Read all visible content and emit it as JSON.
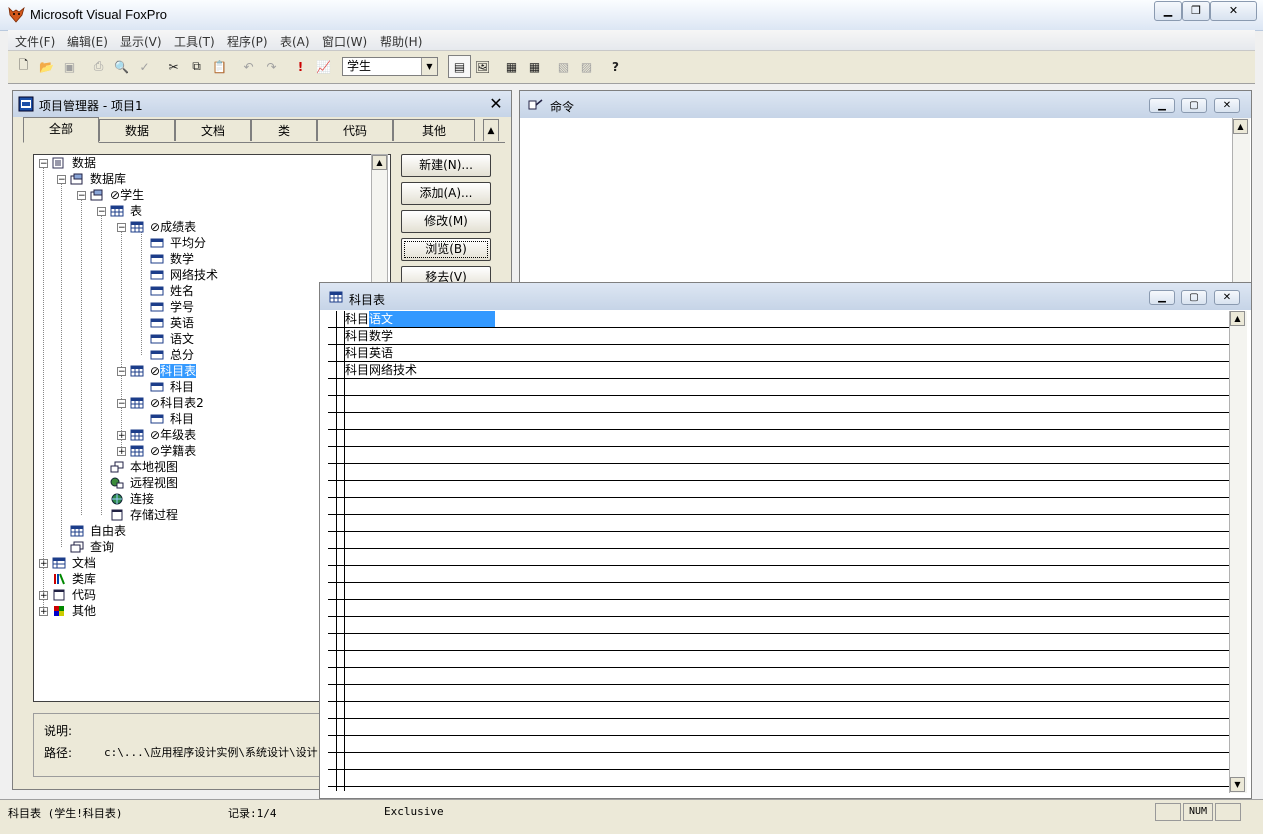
{
  "window": {
    "title": "Microsoft Visual FoxPro"
  },
  "menu": [
    "文件(F)",
    "编辑(E)",
    "显示(V)",
    "工具(T)",
    "程序(P)",
    "表(A)",
    "窗口(W)",
    "帮助(H)"
  ],
  "toolbar": {
    "database_select": "学生",
    "help_icon": "?"
  },
  "project_manager": {
    "title": "项目管理器 - 项目1",
    "tabs": [
      "全部",
      "数据",
      "文档",
      "类",
      "代码",
      "其他"
    ],
    "tree": {
      "data": "数据",
      "database": "数据库",
      "db_student": "学生",
      "tables": "表",
      "t_score": "成绩表",
      "score_fields": [
        "平均分",
        "数学",
        "网络技术",
        "姓名",
        "学号",
        "英语",
        "语文",
        "总分"
      ],
      "t_subject": "科目表",
      "t_subject_fields": [
        "科目"
      ],
      "t_subject2": "科目表2",
      "t_subject2_fields": [
        "科目"
      ],
      "t_grade": "年级表",
      "t_roll": "学籍表",
      "local_view": "本地视图",
      "remote_view": "远程视图",
      "connection": "连接",
      "stored_proc": "存储过程",
      "free_table": "自由表",
      "query": "查询",
      "docs": "文档",
      "class_lib": "类库",
      "code": "代码",
      "other": "其他"
    },
    "buttons": [
      "新建(N)...",
      "添加(A)...",
      "修改(M)",
      "浏览(B)",
      "移去(V)"
    ],
    "desc_label": "说明:",
    "path_label": "路径:",
    "path_value": "c:\\...\\应用程序设计实例\\系统设计\\设计"
  },
  "command_window": {
    "title": "命令"
  },
  "browse_window": {
    "title": "科目表",
    "rows": [
      {
        "prefix": "科目",
        "value": "语文"
      },
      {
        "prefix": "科目",
        "value": "数学"
      },
      {
        "prefix": "科目",
        "value": "英语"
      },
      {
        "prefix": "科目",
        "value": "网络技术"
      }
    ]
  },
  "statusbar": {
    "table": "科目表 (学生!科目表)",
    "record": "记录:1/4",
    "mode": "Exclusive",
    "num": "NUM"
  },
  "colors": {
    "selection": "#3399ff",
    "title_grad": "#c6d4e7"
  }
}
